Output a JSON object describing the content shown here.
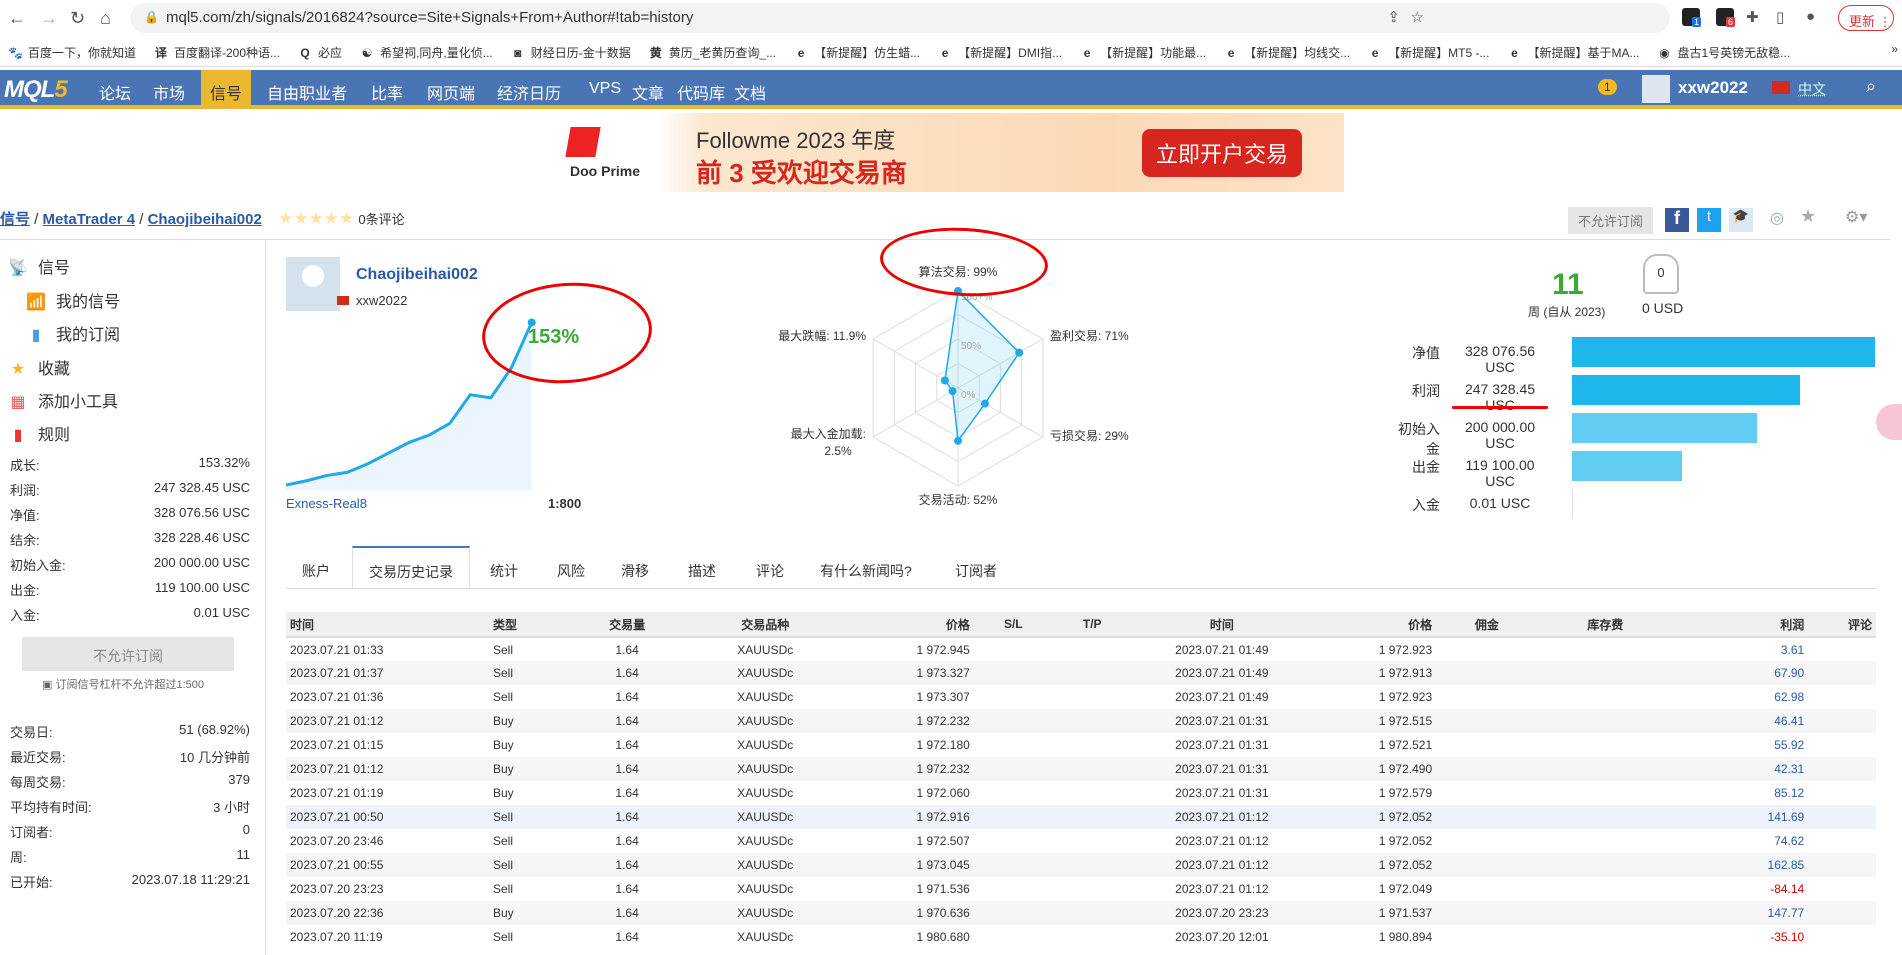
{
  "browser": {
    "url": "mql5.com/zh/signals/2016824?source=Site+Signals+From+Author#!tab=history",
    "update_label": "更新",
    "ext_badges": [
      "1",
      "6"
    ]
  },
  "bookmarks": [
    "百度一下，你就知道",
    "百度翻译-200种语...",
    "必应",
    "希望祠,同舟,量化侦...",
    "财经日历-金十数据",
    "黄历_老黄历查询_...",
    "【新提醒】仿生蜡...",
    "【新提醒】DMI指...",
    "【新提醒】功能最...",
    "【新提醒】均线交...",
    "【新提醒】MT5 -...",
    "【新提醒】基于MA...",
    "盘古1号英镑无敌稳..."
  ],
  "nav": {
    "logo_a": "MQL",
    "logo_b": "5",
    "items": [
      "论坛",
      "市场",
      "信号",
      "自由职业者",
      "比率",
      "网页端",
      "经济日历",
      "VPS",
      "文章",
      "代码库",
      "文档"
    ],
    "active": "信号",
    "notif": "1",
    "user": "xxw2022",
    "lang": "中文"
  },
  "banner": {
    "brand": "Doo Prime",
    "title": "Followme 2023 年度",
    "subtitle": "前 3 受欢迎交易商",
    "cta": "立即开户交易"
  },
  "breadcrumb": {
    "items": [
      "信号",
      "MetaTrader 4",
      "Chaojibeihai002"
    ],
    "reviews": "0条评论"
  },
  "actions": {
    "no_subscribe": "不允许订阅"
  },
  "sidebar": {
    "menu": [
      "信号",
      "我的信号",
      "我的订阅",
      "收藏",
      "添加小工具",
      "规则"
    ],
    "stats": [
      {
        "k": "成长:",
        "v": "153.32%"
      },
      {
        "k": "利润:",
        "v": "247 328.45 USC"
      },
      {
        "k": "净值:",
        "v": "328 076.56 USC"
      },
      {
        "k": "结余:",
        "v": "328 228.46 USC"
      },
      {
        "k": "初始入金:",
        "v": "200 000.00 USC"
      },
      {
        "k": "出金:",
        "v": "119 100.00 USC"
      },
      {
        "k": "入金:",
        "v": "0.01 USC"
      }
    ],
    "button": "不允许订阅",
    "note": "订阅信号杠杆不允许超过1:500",
    "stats2": [
      {
        "k": "交易日:",
        "v": "51 (68.92%)"
      },
      {
        "k": "最近交易:",
        "v": "10 几分钟前"
      },
      {
        "k": "每周交易:",
        "v": "379"
      },
      {
        "k": "平均持有时间:",
        "v": "3 小时"
      },
      {
        "k": "订阅者:",
        "v": "0"
      },
      {
        "k": "周:",
        "v": "11"
      },
      {
        "k": "已开始:",
        "v": "2023.07.18 11:29:21"
      }
    ]
  },
  "profile": {
    "name": "Chaojibeihai002",
    "user": "xxw2022",
    "growth": "153%",
    "server": "Exness-Real8",
    "leverage": "1:800",
    "curve": [
      0,
      4,
      9,
      12,
      20,
      30,
      40,
      47,
      58,
      85,
      82,
      110,
      153
    ]
  },
  "radar": {
    "axes": [
      {
        "label": "算法交易: 99%",
        "value": 99
      },
      {
        "label": "盈利交易: 71%",
        "value": 71
      },
      {
        "label": "亏损交易: 29%",
        "value": 29
      },
      {
        "label": "交易活动: 52%",
        "value": 52
      },
      {
        "label": "最大入金加载:",
        "label2": "2.5%",
        "value": 2.5
      },
      {
        "label": "最大跌幅: 11.9%",
        "value": 11.9
      }
    ],
    "ticks": [
      "100+%",
      "50%",
      "0%"
    ]
  },
  "summary": {
    "weeks": "11",
    "weeks_label": "周 (自从 2023)",
    "subscribers": "0",
    "usd": "0 USD",
    "bars": [
      {
        "k": "净值",
        "v": "328 076.56 USC",
        "amount": 328076.56,
        "color": "#1fb6ec"
      },
      {
        "k": "利润",
        "v": "247 328.45 USC",
        "amount": 247328.45,
        "color": "#1fb6ec"
      },
      {
        "k": "初始入金",
        "v": "200 000.00 USC",
        "amount": 200000,
        "color": "#62cdf2"
      },
      {
        "k": "出金",
        "v": "119 100.00 USC",
        "amount": 119100,
        "color": "#62cdf2"
      },
      {
        "k": "入金",
        "v": "0.01 USC",
        "amount": 0.01,
        "color": "#62cdf2"
      }
    ]
  },
  "tabs": [
    "账户",
    "交易历史记录",
    "统计",
    "风险",
    "滑移",
    "描述",
    "评论",
    "有什么新闻吗?",
    "订阅者"
  ],
  "active_tab": "交易历史记录",
  "table": {
    "headers": [
      "时间",
      "类型",
      "交易量",
      "交易品种",
      "价格",
      "S/L",
      "T/P",
      "时间",
      "价格",
      "佣金",
      "库存费",
      "利润",
      "评论"
    ],
    "rows": [
      [
        "2023.07.21 01:33",
        "Sell",
        "1.64",
        "XAUUSDc",
        "1 972.945",
        "",
        "",
        "2023.07.21 01:49",
        "1 972.923",
        "",
        "",
        "3.61",
        ""
      ],
      [
        "2023.07.21 01:37",
        "Sell",
        "1.64",
        "XAUUSDc",
        "1 973.327",
        "",
        "",
        "2023.07.21 01:49",
        "1 972.913",
        "",
        "",
        "67.90",
        ""
      ],
      [
        "2023.07.21 01:36",
        "Sell",
        "1.64",
        "XAUUSDc",
        "1 973.307",
        "",
        "",
        "2023.07.21 01:49",
        "1 972.923",
        "",
        "",
        "62.98",
        ""
      ],
      [
        "2023.07.21 01:12",
        "Buy",
        "1.64",
        "XAUUSDc",
        "1 972.232",
        "",
        "",
        "2023.07.21 01:31",
        "1 972.515",
        "",
        "",
        "46.41",
        ""
      ],
      [
        "2023.07.21 01:15",
        "Buy",
        "1.64",
        "XAUUSDc",
        "1 972.180",
        "",
        "",
        "2023.07.21 01:31",
        "1 972.521",
        "",
        "",
        "55.92",
        ""
      ],
      [
        "2023.07.21 01:12",
        "Buy",
        "1.64",
        "XAUUSDc",
        "1 972.232",
        "",
        "",
        "2023.07.21 01:31",
        "1 972.490",
        "",
        "",
        "42.31",
        ""
      ],
      [
        "2023.07.21 01:19",
        "Buy",
        "1.64",
        "XAUUSDc",
        "1 972.060",
        "",
        "",
        "2023.07.21 01:31",
        "1 972.579",
        "",
        "",
        "85.12",
        ""
      ],
      [
        "2023.07.21 00:50",
        "Sell",
        "1.64",
        "XAUUSDc",
        "1 972.916",
        "",
        "",
        "2023.07.21 01:12",
        "1 972.052",
        "",
        "",
        "141.69",
        ""
      ],
      [
        "2023.07.20 23:46",
        "Sell",
        "1.64",
        "XAUUSDc",
        "1 972.507",
        "",
        "",
        "2023.07.21 01:12",
        "1 972.052",
        "",
        "",
        "74.62",
        ""
      ],
      [
        "2023.07.21 00:55",
        "Sell",
        "1.64",
        "XAUUSDc",
        "1 973.045",
        "",
        "",
        "2023.07.21 01:12",
        "1 972.052",
        "",
        "",
        "162.85",
        ""
      ],
      [
        "2023.07.20 23:23",
        "Sell",
        "1.64",
        "XAUUSDc",
        "1 971.536",
        "",
        "",
        "2023.07.21 01:12",
        "1 972.049",
        "",
        "",
        "-84.14",
        ""
      ],
      [
        "2023.07.20 22:36",
        "Buy",
        "1.64",
        "XAUUSDc",
        "1 970.636",
        "",
        "",
        "2023.07.20 23:23",
        "1 971.537",
        "",
        "",
        "147.77",
        ""
      ],
      [
        "2023.07.20 11:19",
        "Sell",
        "1.64",
        "XAUUSDc",
        "1 980.680",
        "",
        "",
        "2023.07.20 12:01",
        "1 980.894",
        "",
        "",
        "-35.10",
        ""
      ]
    ]
  }
}
